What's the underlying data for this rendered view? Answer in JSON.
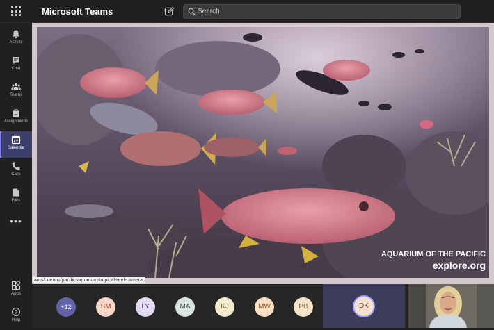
{
  "app": {
    "title": "Microsoft Teams"
  },
  "search": {
    "placeholder": "Search"
  },
  "rail": {
    "items": [
      {
        "label": "Activity",
        "icon": "bell-icon"
      },
      {
        "label": "Chat",
        "icon": "chat-icon"
      },
      {
        "label": "Teams",
        "icon": "teams-icon"
      },
      {
        "label": "Assignments",
        "icon": "assignments-icon"
      },
      {
        "label": "Calendar",
        "icon": "calendar-icon",
        "active": true
      },
      {
        "label": "Calls",
        "icon": "phone-icon"
      },
      {
        "label": "Files",
        "icon": "file-icon"
      }
    ],
    "more": "•••",
    "bottom": [
      {
        "label": "Apps",
        "icon": "apps-icon"
      },
      {
        "label": "Help",
        "icon": "help-icon"
      }
    ]
  },
  "stage": {
    "watermark_line1": "AQUARIUM OF THE PACIFIC",
    "watermark_line2": "explore.org",
    "url_tooltip": "ams/oceans/pacific-aquarium-tropical-reef-camera"
  },
  "participants": {
    "overflow": "+12",
    "avatars": [
      {
        "initials": "SM",
        "bg": "#f6d7c9",
        "fg": "#8a3d2b"
      },
      {
        "initials": "LY",
        "bg": "#e2d9f3",
        "fg": "#5a4a8a"
      },
      {
        "initials": "MA",
        "bg": "#d9e4e1",
        "fg": "#3c5a55"
      },
      {
        "initials": "KJ",
        "bg": "#f2ebcf",
        "fg": "#7a6a2b"
      },
      {
        "initials": "MW",
        "bg": "#f9dfc4",
        "fg": "#8a5a2b"
      },
      {
        "initials": "PB",
        "bg": "#f6e3c9",
        "fg": "#7a5a2b"
      }
    ],
    "speaker": {
      "initials": "DK",
      "bg": "#f6e0cf",
      "fg": "#6a4a3a"
    }
  },
  "colors": {
    "accent": "#6264a7",
    "rail_active": "#3c3f6b"
  }
}
